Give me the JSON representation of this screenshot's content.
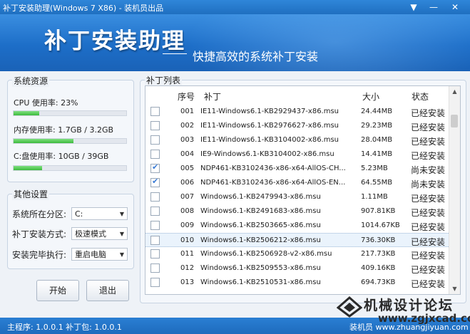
{
  "window": {
    "title": "补丁安装助理(Windows 7 X86) - 装机员出品"
  },
  "banner": {
    "title": "补丁安装助理",
    "subtitle": "快捷高效的系统补丁安装"
  },
  "system": {
    "group_title": "系统资源",
    "stats": [
      {
        "label": "CPU 使用率: 23%",
        "percent": 23
      },
      {
        "label": "内存使用率: 1.7GB / 3.2GB",
        "percent": 53
      },
      {
        "label": "C:盘使用率: 10GB / 39GB",
        "percent": 25
      }
    ]
  },
  "settings": {
    "group_title": "其他设置",
    "partition_label": "系统所在分区:",
    "partition_value": "C:",
    "method_label": "补丁安装方式:",
    "method_value": "极速模式",
    "after_label": "安装完毕执行:",
    "after_value": "重启电脑"
  },
  "buttons": {
    "start": "开始",
    "exit": "退出"
  },
  "patch_list": {
    "group_title": "补丁列表",
    "headers": {
      "seq": "序号",
      "name": "补丁",
      "size": "大小",
      "status": "状态"
    },
    "rows": [
      {
        "seq": "001",
        "name": "IE11-Windows6.1-KB2929437-x86.msu",
        "size": "24.44MB",
        "status": "已经安装",
        "checked": false
      },
      {
        "seq": "002",
        "name": "IE11-Windows6.1-KB2976627-x86.msu",
        "size": "29.23MB",
        "status": "已经安装",
        "checked": false
      },
      {
        "seq": "003",
        "name": "IE11-Windows6.1-KB3104002-x86.msu",
        "size": "28.04MB",
        "status": "已经安装",
        "checked": false
      },
      {
        "seq": "004",
        "name": "IE9-Windows6.1-KB3104002-x86.msu",
        "size": "14.41MB",
        "status": "已经安装",
        "checked": false
      },
      {
        "seq": "005",
        "name": "NDP461-KB3102436-x86-x64-AllOS-CH...",
        "size": "5.23MB",
        "status": "尚未安装",
        "checked": true
      },
      {
        "seq": "006",
        "name": "NDP461-KB3102436-x86-x64-AllOS-EN...",
        "size": "64.55MB",
        "status": "尚未安装",
        "checked": true
      },
      {
        "seq": "007",
        "name": "Windows6.1-KB2479943-x86.msu",
        "size": "1.11MB",
        "status": "已经安装",
        "checked": false
      },
      {
        "seq": "008",
        "name": "Windows6.1-KB2491683-x86.msu",
        "size": "907.81KB",
        "status": "已经安装",
        "checked": false
      },
      {
        "seq": "009",
        "name": "Windows6.1-KB2503665-x86.msu",
        "size": "1014.67KB",
        "status": "已经安装",
        "checked": false
      },
      {
        "seq": "010",
        "name": "Windows6.1-KB2506212-x86.msu",
        "size": "736.30KB",
        "status": "已经安装",
        "checked": false,
        "selected": true
      },
      {
        "seq": "011",
        "name": "Windows6.1-KB2506928-v2-x86.msu",
        "size": "217.73KB",
        "status": "已经安装",
        "checked": false
      },
      {
        "seq": "012",
        "name": "Windows6.1-KB2509553-x86.msu",
        "size": "409.16KB",
        "status": "已经安装",
        "checked": false
      },
      {
        "seq": "013",
        "name": "Windows6.1-KB2510531-x86.msu",
        "size": "694.73KB",
        "status": "已经安装",
        "checked": false
      }
    ]
  },
  "statusbar": {
    "left": "主程序: 1.0.0.1 补丁包: 1.0.0.1",
    "right": "装机员 www.zhuangjiyuan.com"
  },
  "watermark": {
    "cn": "机械设计论坛",
    "url": "www.zgjxcad.com"
  },
  "colors": {
    "titlebar": "#1f6fc0",
    "progress": "#3dbb3d",
    "check": "#3a7bd5"
  }
}
